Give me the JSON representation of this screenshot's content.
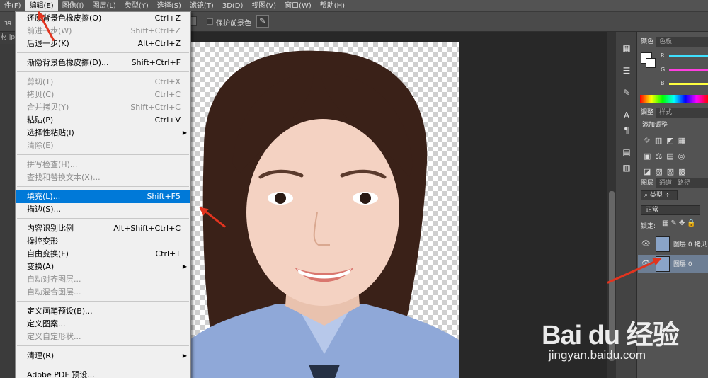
{
  "menubar": {
    "items": [
      {
        "label": "件(F)"
      },
      {
        "label": "编辑(E)"
      },
      {
        "label": "图像(I)"
      },
      {
        "label": "图层(L)"
      },
      {
        "label": "类型(Y)"
      },
      {
        "label": "选择(S)"
      },
      {
        "label": "滤镜(T)"
      },
      {
        "label": "3D(D)"
      },
      {
        "label": "视图(V)"
      },
      {
        "label": "窗口(W)"
      },
      {
        "label": "帮助(H)"
      }
    ]
  },
  "options": {
    "brush_size": "39",
    "protect_fg_label": "保护前景色"
  },
  "doc_tab": {
    "label": "材.jpg"
  },
  "edit_menu": {
    "items": [
      {
        "label": "还原背景色橡皮擦(O)",
        "shortcut": "Ctrl+Z"
      },
      {
        "label": "前进一步(W)",
        "shortcut": "Shift+Ctrl+Z"
      },
      {
        "label": "后退一步(K)",
        "shortcut": "Alt+Ctrl+Z"
      },
      {
        "label": "渐隐背景色橡皮擦(D)...",
        "shortcut": "Shift+Ctrl+F"
      },
      {
        "label": "剪切(T)",
        "shortcut": "Ctrl+X"
      },
      {
        "label": "拷贝(C)",
        "shortcut": "Ctrl+C"
      },
      {
        "label": "合并拷贝(Y)",
        "shortcut": "Shift+Ctrl+C"
      },
      {
        "label": "粘贴(P)",
        "shortcut": "Ctrl+V"
      },
      {
        "label": "选择性粘贴(I)",
        "shortcut": ""
      },
      {
        "label": "清除(E)",
        "shortcut": ""
      },
      {
        "label": "拼写检查(H)...",
        "shortcut": ""
      },
      {
        "label": "查找和替换文本(X)...",
        "shortcut": ""
      },
      {
        "label": "填充(L)...",
        "shortcut": "Shift+F5"
      },
      {
        "label": "描边(S)...",
        "shortcut": ""
      },
      {
        "label": "内容识别比例",
        "shortcut": "Alt+Shift+Ctrl+C"
      },
      {
        "label": "操控变形",
        "shortcut": ""
      },
      {
        "label": "自由变换(F)",
        "shortcut": "Ctrl+T"
      },
      {
        "label": "变换(A)",
        "shortcut": ""
      },
      {
        "label": "自动对齐图层...",
        "shortcut": ""
      },
      {
        "label": "自动混合图层...",
        "shortcut": ""
      },
      {
        "label": "定义画笔预设(B)...",
        "shortcut": ""
      },
      {
        "label": "定义图案...",
        "shortcut": ""
      },
      {
        "label": "定义自定形状...",
        "shortcut": ""
      },
      {
        "label": "清理(R)",
        "shortcut": ""
      },
      {
        "label": "Adobe PDF 预设...",
        "shortcut": ""
      }
    ]
  },
  "color_panel": {
    "tabs": [
      "颜色",
      "色板"
    ],
    "channels": [
      "R",
      "G",
      "B"
    ]
  },
  "adjust_panel": {
    "tabs": [
      "调整",
      "样式"
    ],
    "title": "添加调整"
  },
  "layers_panel": {
    "tabs": [
      "图层",
      "通道",
      "路径"
    ],
    "filter_label": "类型",
    "blend_mode": "正常",
    "lock_label": "锁定:",
    "layers": [
      {
        "name": "图层 0 拷贝"
      },
      {
        "name": "图层 0"
      }
    ]
  },
  "watermark": {
    "logo": "Bai du 经验",
    "url": "jingyan.baidu.com"
  },
  "colors": {
    "highlight": "#0079d8",
    "arrow": "#e2341f"
  }
}
